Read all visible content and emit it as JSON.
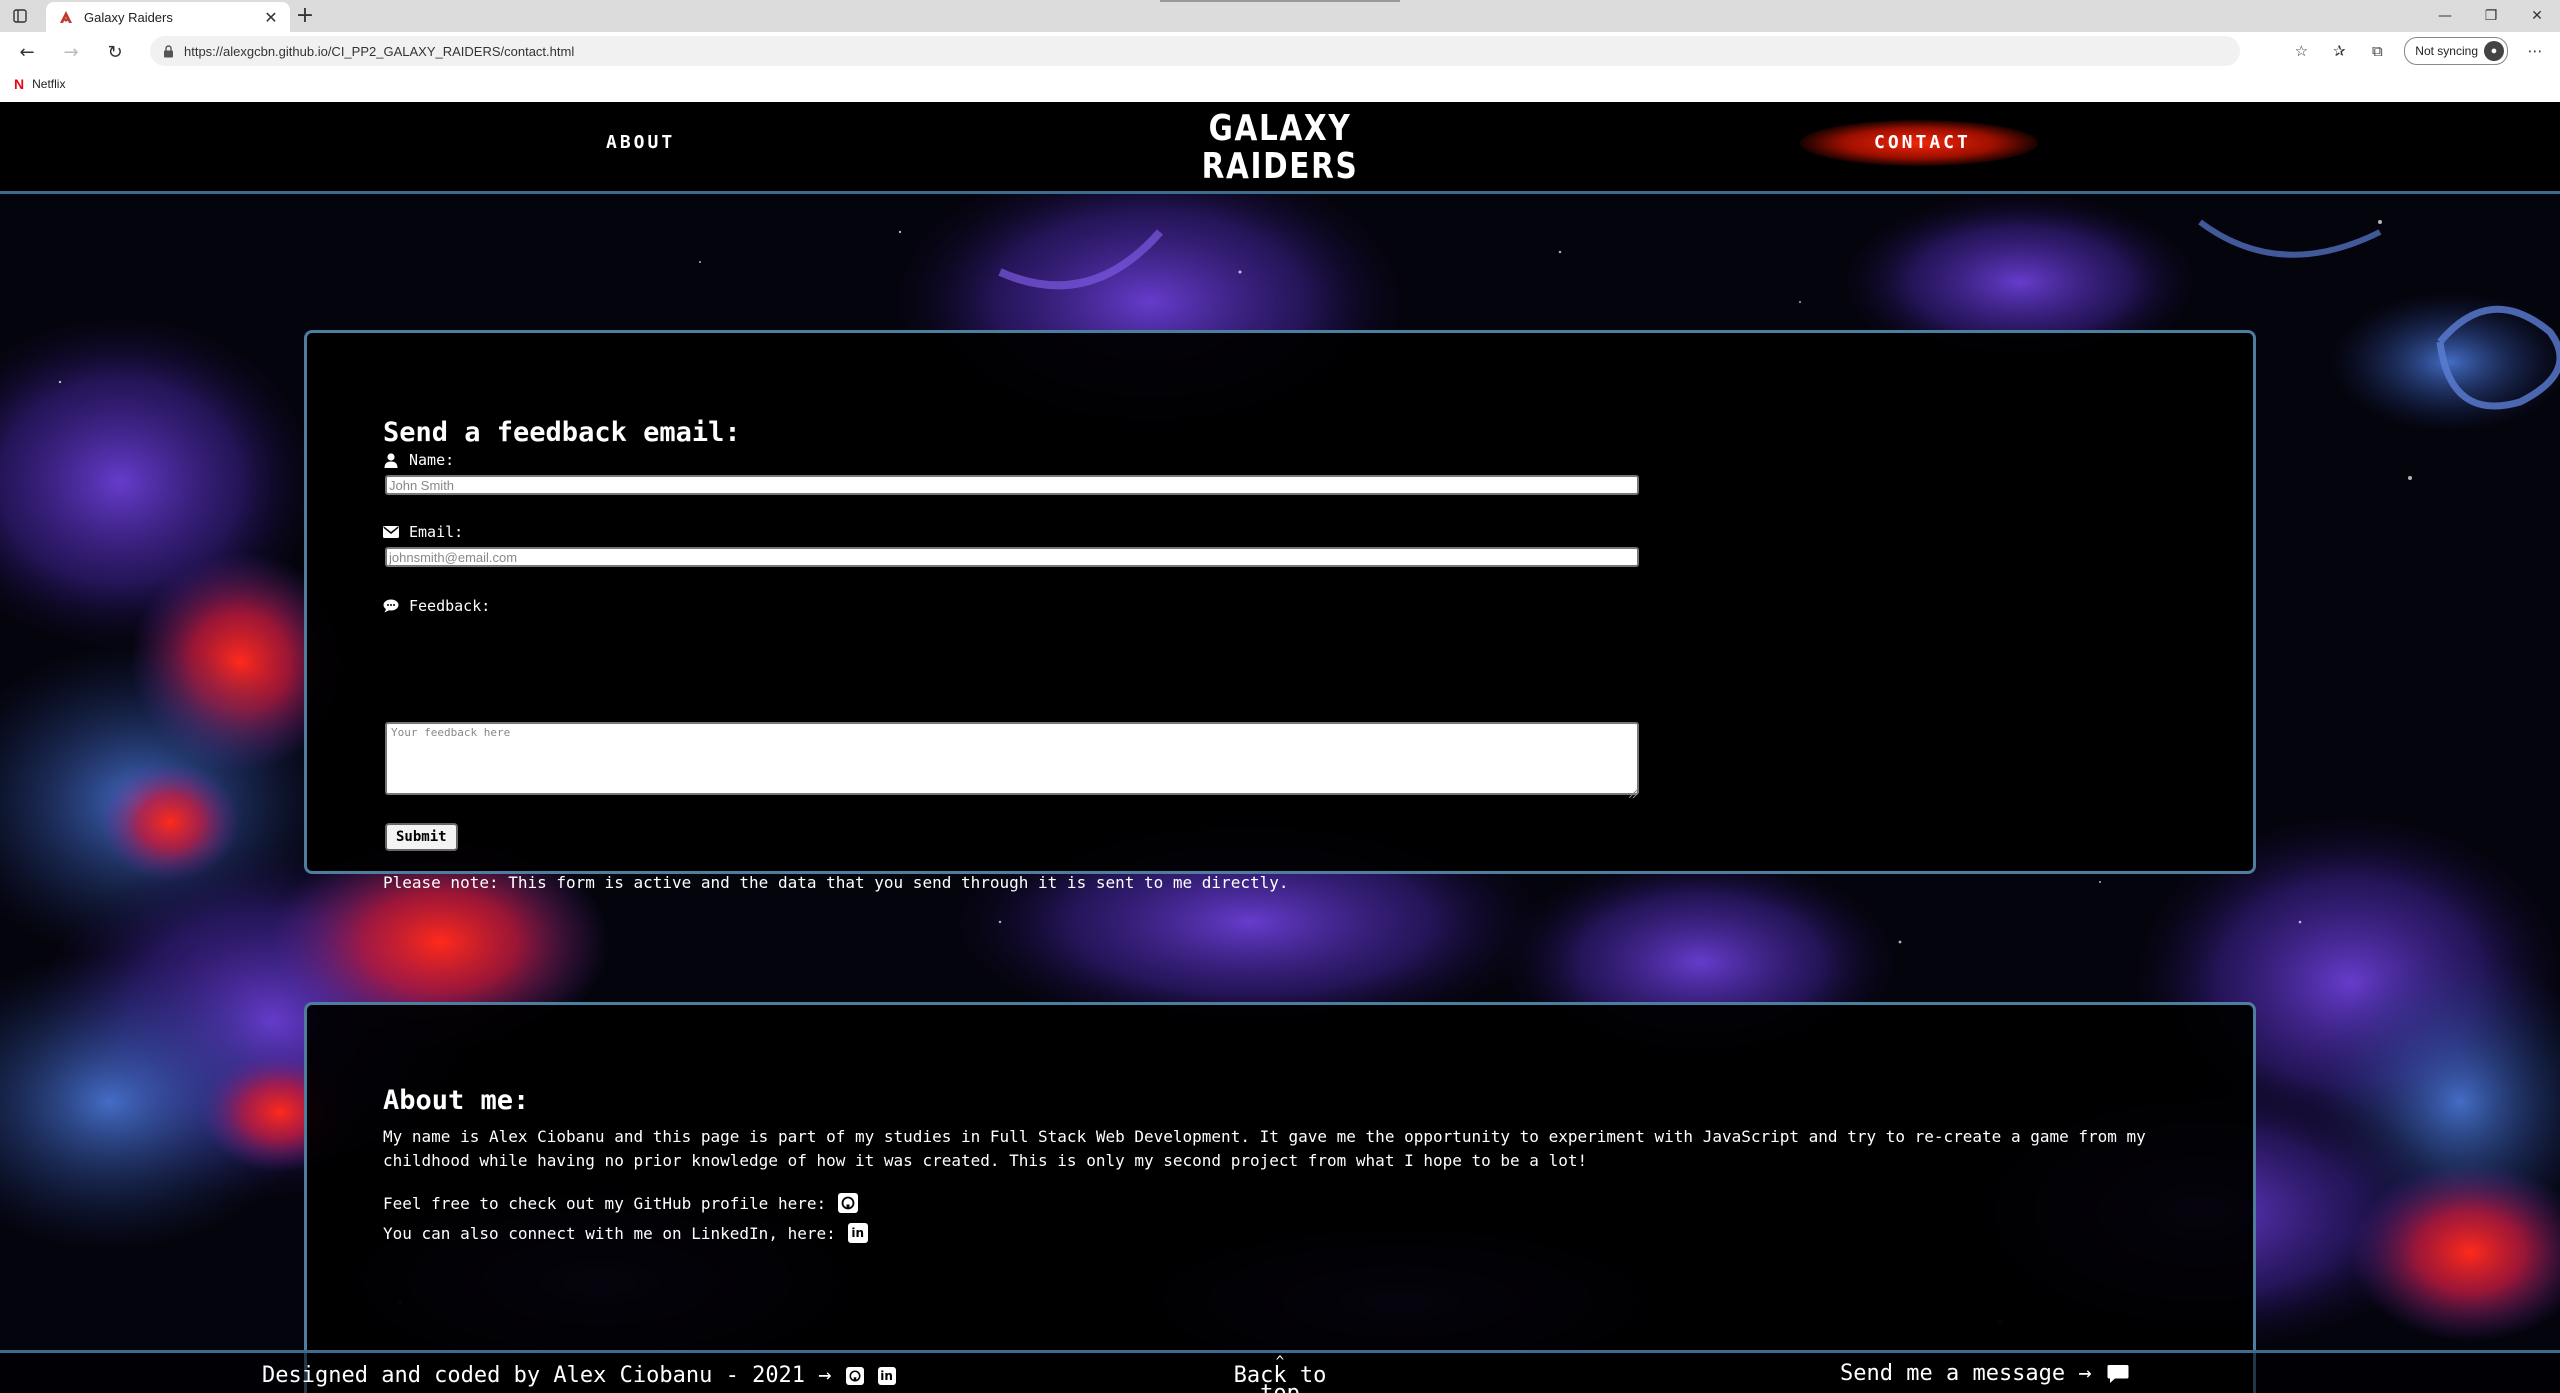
{
  "browser": {
    "tab_title": "Galaxy Raiders",
    "url": "https://alexgcbn.github.io/CI_PP2_GALAXY_RAIDERS/contact.html",
    "sync_label": "Not syncing",
    "bookmark_label": "Netflix",
    "netflix_letter": "N"
  },
  "nav": {
    "about": "ABOUT",
    "logo_line1": "GALAXY",
    "logo_line2": "RAIDERS",
    "contact": "CONTACT"
  },
  "form": {
    "heading": "Send a feedback email:",
    "name_label": "Name:",
    "name_placeholder": "John Smith",
    "email_label": "Email:",
    "email_placeholder": "johnsmith@email.com",
    "feedback_label": "Feedback:",
    "feedback_placeholder": "Your feedback here",
    "submit": "Submit",
    "note": "Please note: This form is active and the data that you send through it is sent to me directly."
  },
  "about": {
    "heading": "About me:",
    "text": "My name is Alex Ciobanu and this page is part of my studies in Full Stack Web Development. It gave me the opportunity to experiment with JavaScript and try to re-create a game from my childhood while having no prior knowledge of how it was created. This is only my second project from what I hope to be a lot!",
    "github_line": "Feel free to check out my GitHub profile here:",
    "linkedin_line": "You can also connect with me on LinkedIn, here:",
    "linkedin_icon_text": "in"
  },
  "footer": {
    "credit": "Designed and coded by Alex Ciobanu - 2021 →",
    "back_arrow": "^",
    "back_line1": "Back to top",
    "message": "Send me a message →"
  },
  "icons": {
    "page_icon": "galaxy-raiders-favicon",
    "name": "user-icon",
    "email": "envelope-icon",
    "feedback": "comment-icon",
    "github": "github-icon",
    "linkedin": "linkedin-icon",
    "message": "chat-bubble-icon"
  },
  "colors": {
    "panel_border": "#4d7d9f",
    "contact_glow": "#ff2a0a",
    "page_bg": "#000000"
  }
}
